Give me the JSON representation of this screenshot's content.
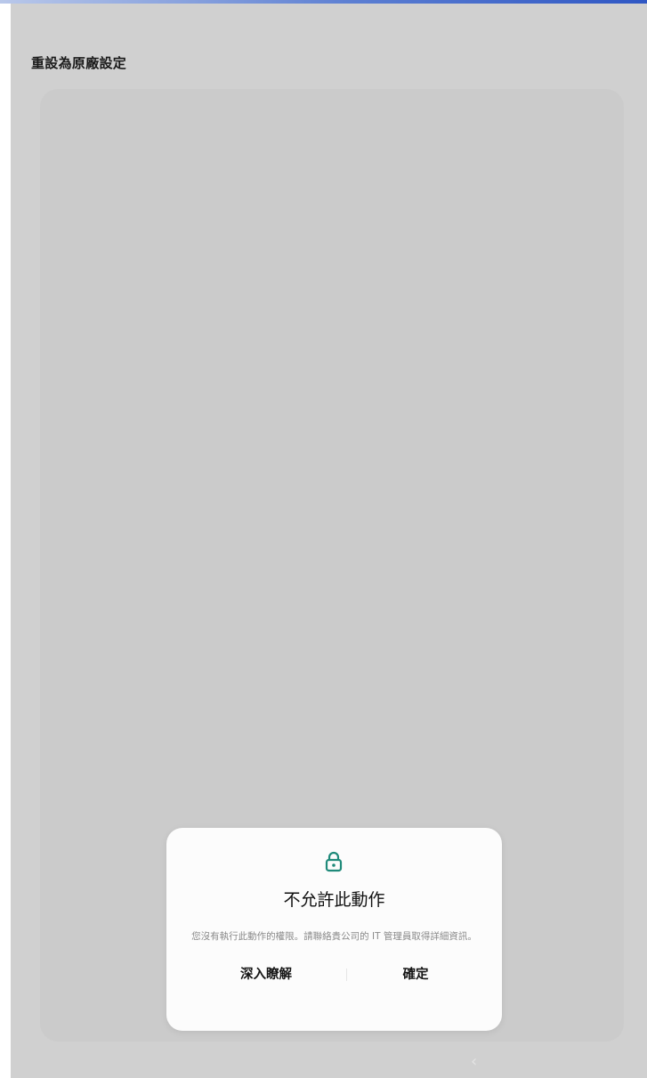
{
  "header": {
    "title": "重設為原廠設定"
  },
  "dialog": {
    "icon": "lock-icon",
    "title": "不允許此動作",
    "message": "您沒有執行此動作的權限。請聯絡貴公司的 IT 管理員取得詳細資訊。",
    "learn_more_label": "深入瞭解",
    "ok_label": "確定"
  },
  "nav": {
    "back_glyph": "‹"
  },
  "colors": {
    "accent": "#1f8a7a",
    "screen_dim": "#d0d0d0",
    "dialog_bg": "#fcfcfc"
  }
}
